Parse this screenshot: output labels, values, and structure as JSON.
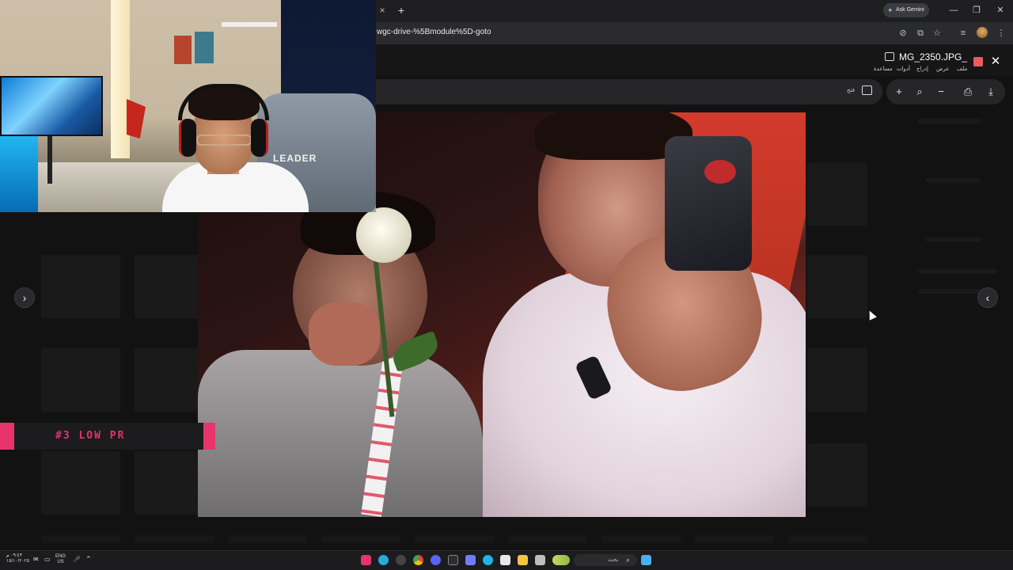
{
  "browser": {
    "url": "wgc-drive-%5Bmodule%5D-goto",
    "ask_gemini": "Ask Gemini",
    "new_tab_glyph": "+",
    "close_tab_glyph": "×",
    "window_controls": [
      "—",
      "❐",
      "✕"
    ]
  },
  "viewer": {
    "file_name": "MG_2350.JPG_",
    "menu": [
      "ملف",
      "عرض",
      "إدراج",
      "أدوات",
      "مساعدة"
    ],
    "open_with_label": "فتح",
    "toolbar": {
      "zoom_in": "+",
      "zoom_out_glyph": "−",
      "search_glyph": "⌕",
      "print_glyph": "⎙",
      "download_glyph": "⤓"
    },
    "close_glyph": "✕",
    "prev_glyph": "›",
    "next_glyph": "‹"
  },
  "webcam": {
    "chair_text": "LEADER"
  },
  "stream_banner": {
    "text": "#3 LOW PR"
  },
  "taskbar": {
    "time": "٠٩:٤٣ م",
    "date": "١٥/١٠/٢٠٢٥",
    "lang_top": "ENG",
    "lang_bottom": "US",
    "search_label": "بحث"
  },
  "colors": {
    "banner_accent": "#e8336d",
    "viewer_bg": "#121213",
    "photo_red": "#d23a2c"
  }
}
